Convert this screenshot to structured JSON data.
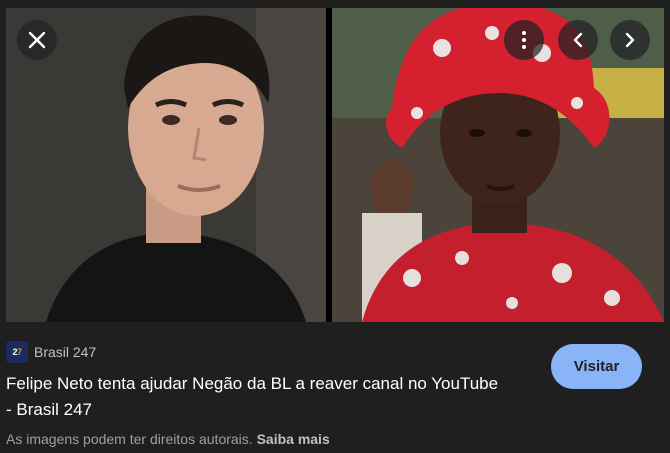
{
  "viewer": {
    "close_icon": "close-icon",
    "more_icon": "more-vert-icon",
    "prev_icon": "chevron-left-icon",
    "next_icon": "chevron-right-icon"
  },
  "source": {
    "favicon_text_a": "2",
    "favicon_text_b": "7",
    "name": "Brasil 247"
  },
  "title": "Felipe Neto tenta ajudar Negão da BL a reaver canal no YouTube - Brasil 247",
  "visit_label": "Visitar",
  "copyright": {
    "text": "As imagens podem ter direitos autorais.",
    "learn_more": "Saiba mais"
  },
  "colors": {
    "background": "#1f1f1f",
    "visit_button": "#8ab4f8",
    "title": "#ffffff",
    "muted": "#9aa0a6"
  }
}
